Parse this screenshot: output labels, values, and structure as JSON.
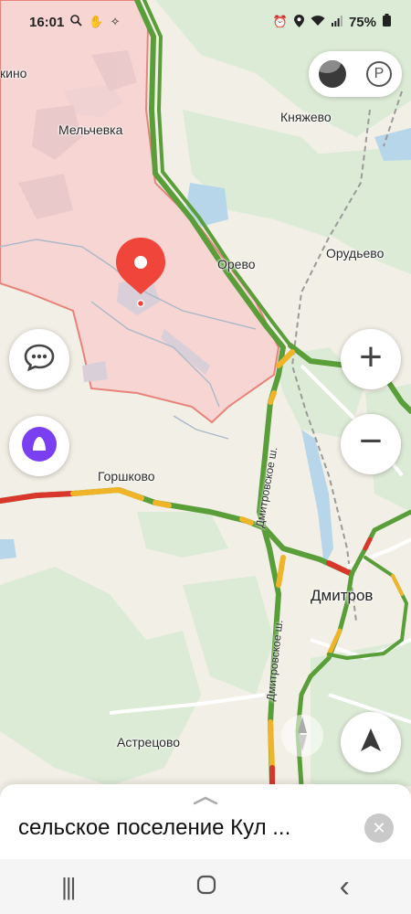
{
  "status_bar": {
    "time": "16:01",
    "left_icons": [
      "search-icon",
      "hand-icon",
      "wand-icon"
    ],
    "right_icons": [
      "alarm-icon",
      "location-icon",
      "wifi-icon",
      "signal-icon"
    ],
    "battery": "75%"
  },
  "map": {
    "labels": {
      "kino": "кино",
      "melchevka": "Мельчевка",
      "knyazhevo": "Княжево",
      "orevo": "Орево",
      "orudevo": "Орудьево",
      "gorshkovo": "Горшково",
      "dmitrov": "Дмитров",
      "astretsovo": "Астрецово"
    },
    "road_labels": {
      "dmitrovskoe_1": "Дмитровское ш.",
      "dmitrovskoe_2": "Дмитровское ш."
    },
    "colors": {
      "region_fill": "#f6d2cf",
      "region_border": "#e7837a",
      "traffic_green": "#5a9e3a",
      "traffic_yellow": "#f0b429",
      "traffic_red": "#d9372b",
      "pin": "#f0453a",
      "alice": "#7b3ff2"
    }
  },
  "controls": {
    "layers_icon": "layers-icon",
    "parking_label": "P",
    "zoom_in": "+",
    "zoom_out": "−"
  },
  "sheet": {
    "title": "сельское поселение Кул ...",
    "close": "✕"
  },
  "navbar": {
    "recent": "|||",
    "home": "◯",
    "back": "‹"
  }
}
